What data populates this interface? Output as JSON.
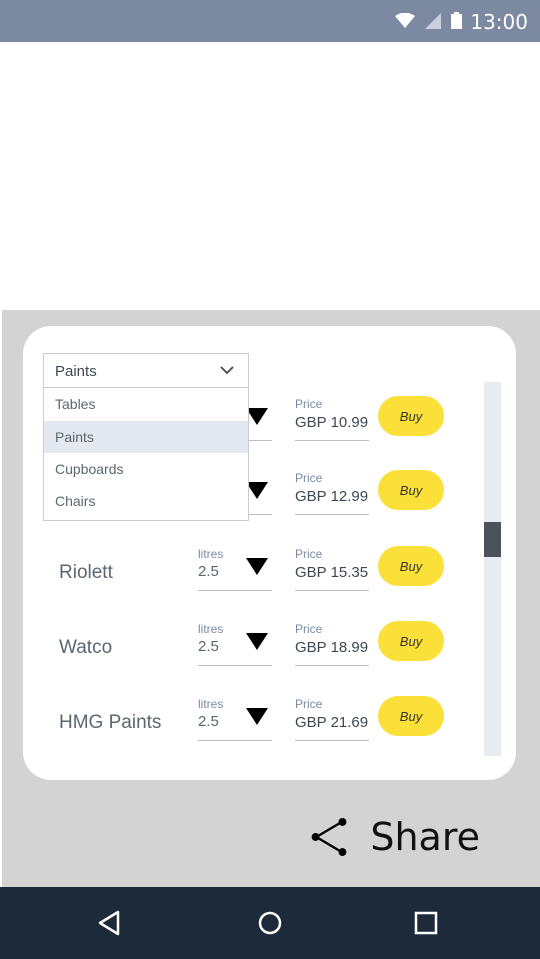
{
  "status_bar": {
    "time": "13:00"
  },
  "dropdown": {
    "selected": "Paints",
    "options": [
      "Tables",
      "Paints",
      "Cupboards",
      "Chairs"
    ]
  },
  "products": [
    {
      "name": "",
      "litres_label": "",
      "litres": "",
      "price_label": "Price",
      "price": "GBP 10.99",
      "buy": "Buy"
    },
    {
      "name": "",
      "litres_label": "",
      "litres": "",
      "price_label": "Price",
      "price": "GBP 12.99",
      "buy": "Buy"
    },
    {
      "name": "Riolett",
      "litres_label": "litres",
      "litres": "2.5",
      "price_label": "Price",
      "price": "GBP 15.35",
      "buy": "Buy"
    },
    {
      "name": "Watco",
      "litres_label": "litres",
      "litres": "2.5",
      "price_label": "Price",
      "price": "GBP 18.99",
      "buy": "Buy"
    },
    {
      "name": "HMG Paints",
      "litres_label": "litres",
      "litres": "2.5",
      "price_label": "Price",
      "price": "GBP 21.69",
      "buy": "Buy"
    }
  ],
  "share": {
    "label": "Share",
    "icon": "share-icon"
  },
  "nav": {
    "icons": [
      "back-icon",
      "home-icon",
      "recents-icon"
    ]
  },
  "colors": {
    "accent": "#fbe03a",
    "status_bar": "#7b8aa1",
    "nav_bar": "#1d2a3a"
  }
}
